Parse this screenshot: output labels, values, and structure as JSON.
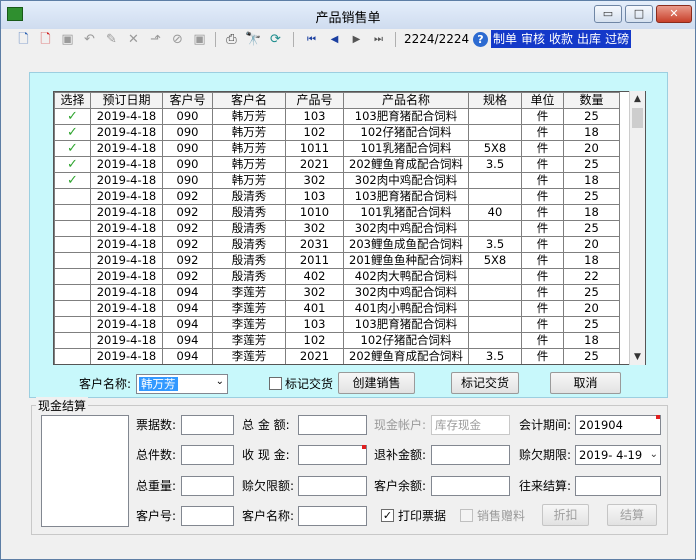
{
  "window": {
    "title": "产品销售单"
  },
  "window_buttons": {
    "minimize": "▭",
    "maximize": "□",
    "close": "✕"
  },
  "toolbar": {
    "icons": [
      "new-doc-icon",
      "new-red-doc-icon",
      "approve-icon",
      "undo-icon",
      "edit-icon",
      "delete-icon",
      "open-icon",
      "cancel-icon",
      "save-icon",
      "print-icon",
      "find-icon",
      "refresh-icon",
      "first-icon",
      "prev-icon",
      "next-icon",
      "last-icon"
    ],
    "glyphs": {
      "new": "🗋",
      "new_red": "🗋",
      "approve": "▣",
      "undo": "↶",
      "edit": "✎",
      "delete": "✕",
      "open": "⬏",
      "cancel": "⊘",
      "save": "▣",
      "print": "⎙",
      "find": "🔭",
      "refresh": "⟳",
      "first": "⏮",
      "prev": "◀",
      "next": "▶",
      "last": "⏭"
    },
    "record": "2224/2224",
    "help": "?",
    "menu": [
      "制单",
      "审核",
      "收款",
      "出库",
      "过磅"
    ]
  },
  "grid": {
    "headers": [
      "选择",
      "预订日期",
      "客户号",
      "客户名",
      "产品号",
      "产品名称",
      "规格",
      "单位",
      "数量"
    ],
    "check_glyph": "✓",
    "rows": [
      [
        true,
        "2019-4-18",
        "090",
        "韩万芳",
        "103",
        "103肥育猪配合饲料",
        "",
        "件",
        "25"
      ],
      [
        true,
        "2019-4-18",
        "090",
        "韩万芳",
        "102",
        "102仔猪配合饲料",
        "",
        "件",
        "18"
      ],
      [
        true,
        "2019-4-18",
        "090",
        "韩万芳",
        "1011",
        "101乳猪配合饲料",
        "5X8",
        "件",
        "20"
      ],
      [
        true,
        "2019-4-18",
        "090",
        "韩万芳",
        "2021",
        "202鲤鱼育成配合饲料",
        "3.5",
        "件",
        "25"
      ],
      [
        true,
        "2019-4-18",
        "090",
        "韩万芳",
        "302",
        "302肉中鸡配合饲料",
        "",
        "件",
        "18"
      ],
      [
        false,
        "2019-4-18",
        "092",
        "殷清秀",
        "103",
        "103肥育猪配合饲料",
        "",
        "件",
        "25"
      ],
      [
        false,
        "2019-4-18",
        "092",
        "殷清秀",
        "1010",
        "101乳猪配合饲料",
        "40",
        "件",
        "18"
      ],
      [
        false,
        "2019-4-18",
        "092",
        "殷清秀",
        "302",
        "302肉中鸡配合饲料",
        "",
        "件",
        "25"
      ],
      [
        false,
        "2019-4-18",
        "092",
        "殷清秀",
        "2031",
        "203鲤鱼成鱼配合饲料",
        "3.5",
        "件",
        "20"
      ],
      [
        false,
        "2019-4-18",
        "092",
        "殷清秀",
        "2011",
        "201鲤鱼鱼种配合饲料",
        "5X8",
        "件",
        "18"
      ],
      [
        false,
        "2019-4-18",
        "092",
        "殷清秀",
        "402",
        "402肉大鸭配合饲料",
        "",
        "件",
        "22"
      ],
      [
        false,
        "2019-4-18",
        "094",
        "李莲芳",
        "302",
        "302肉中鸡配合饲料",
        "",
        "件",
        "25"
      ],
      [
        false,
        "2019-4-18",
        "094",
        "李莲芳",
        "401",
        "401肉小鸭配合饲料",
        "",
        "件",
        "20"
      ],
      [
        false,
        "2019-4-18",
        "094",
        "李莲芳",
        "103",
        "103肥育猪配合饲料",
        "",
        "件",
        "25"
      ],
      [
        false,
        "2019-4-18",
        "094",
        "李莲芳",
        "102",
        "102仔猪配合饲料",
        "",
        "件",
        "18"
      ],
      [
        false,
        "2019-4-18",
        "094",
        "李莲芳",
        "2021",
        "202鲤鱼育成配合饲料",
        "3.5",
        "件",
        "25"
      ]
    ],
    "scroll": {
      "up": "▲",
      "down": "▼"
    }
  },
  "filter": {
    "customer_label": "客户名称:",
    "customer_value": "韩万芳",
    "combo_arrow": "⌄",
    "trade_label": "标记交货",
    "create_button": "创建销售",
    "mark_button": "标记交货",
    "cancel_button": "取消"
  },
  "cash": {
    "title": "现金结算",
    "ticket_count_label": "票据数:",
    "total_amount_label": "总 金 额:",
    "cash_account_label": "现金帐户:",
    "cash_account_placeholder": "库存现金",
    "account_period_label": "会计期间:",
    "account_period_value": "201904",
    "total_pieces_label": "总件数:",
    "cash_received_label": "收 现 金:",
    "refund_label": "退补金额:",
    "credit_deadline_label": "赊欠期限:",
    "credit_deadline_value": "2019- 4-19",
    "total_weight_label": "总重量:",
    "credit_limit_label": "赊欠限额:",
    "customer_balance_label": "客户余额:",
    "transactions_label": "往来结算:",
    "customer_no_label": "客户号:",
    "customer_name_label": "客户名称:",
    "print_ticket_label": "打印票据",
    "print_check": "✓",
    "sale_gift_label": "销售赠料",
    "discount_button": "折扣",
    "settle_button": "结算"
  }
}
